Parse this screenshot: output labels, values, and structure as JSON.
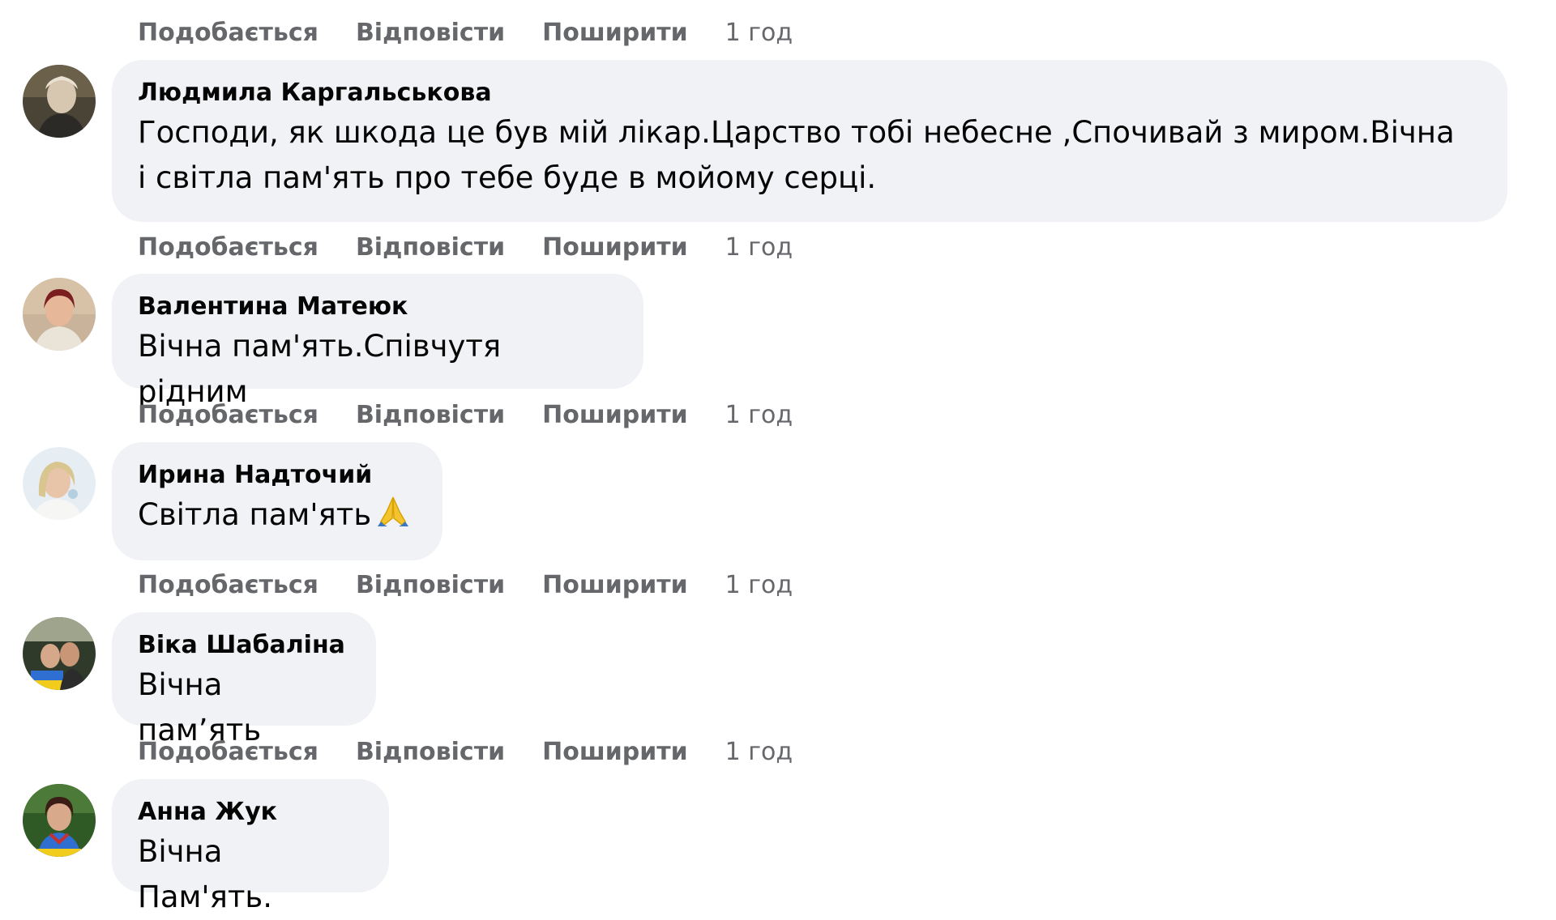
{
  "actions": {
    "like": "Подобається",
    "reply": "Відповісти",
    "share": "Поширити",
    "time": "1 год"
  },
  "comments": [
    {
      "author": "Людмила Каргальськова",
      "text_line1": "Господи, як шкода це був мій лікар.Царство тобі небесне ,Спочивай з миром.Вічна",
      "text_line2": "і світла пам'ять про тебе буде в мойому серці."
    },
    {
      "author": "Валентина Матеюк",
      "text": "Вічна пам'ять.Співчутя рідним"
    },
    {
      "author": "Ирина Надточий",
      "text": "Світла пам'ять",
      "emoji": "folded-hands-icon"
    },
    {
      "author": "Віка Шабаліна",
      "text": "Вічна памʼять"
    },
    {
      "author": "Анна Жук",
      "text": "Вічна Пам'ять."
    }
  ]
}
